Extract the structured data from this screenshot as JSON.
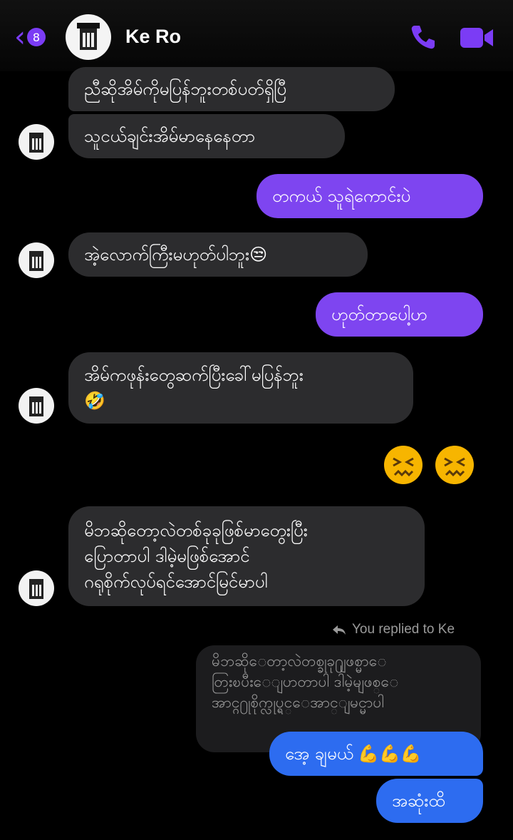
{
  "header": {
    "unread_count": "8",
    "contact_name": "Ke Ro",
    "back_icon": "chevron-left-icon",
    "call_icon": "phone-icon",
    "video_icon": "video-camera-icon",
    "accent_color": "#7b3cf5"
  },
  "messages": {
    "m1": "ညီဆိုအိမ်ကိုမပြန်ဘူးတစ်ပတ်ရှိပြီ",
    "m2": "သူငယ်ချင်းအိမ်မာနေနေတာ",
    "m3": "တကယ် သူရဲကောင်းပဲ",
    "m4": "အဲ့လောက်ကြီးမဟုတ်ပါဘူး😒",
    "m5": "ဟုတ်တာပေါ့ဟ",
    "m6": "အိမ်ကဖုန်းတွေဆက်ပြီးခေါ်မပြန်ဘူး\n🤣",
    "m7_reactions": "😖 😖",
    "m8": "မိဘဆိုတော့လဲတစ်ခုခုဖြစ်မာတွေးပြီး\nပြောတာပါ ဒါမဲ့မဖြစ်အောင်\nဂရုစိုက်လုပ်ရင်အောင်မြင်မာပါ",
    "m9": "အေ့ ချမယ်",
    "m9_emoji": "💪💪💪",
    "m10": "အဆုံးထိ"
  },
  "reply": {
    "label": "You replied to Ke",
    "quoted_text": "မိဘဆိုေတာ့လဲတစ္ခုခု႐ျဖစ္မာေ\nတြးၿပီးေျပာတာပါ ဒါမဲ့မျဖစ္ေ\nအာင္ဂ႐ုစိုက္လုပ္ရင္ေအာင္ျမင္မာပါ"
  },
  "colors": {
    "incoming": "#2c2c2e",
    "outgoing_purple": "#7e45f0",
    "outgoing_blue": "#2d6cf0"
  }
}
